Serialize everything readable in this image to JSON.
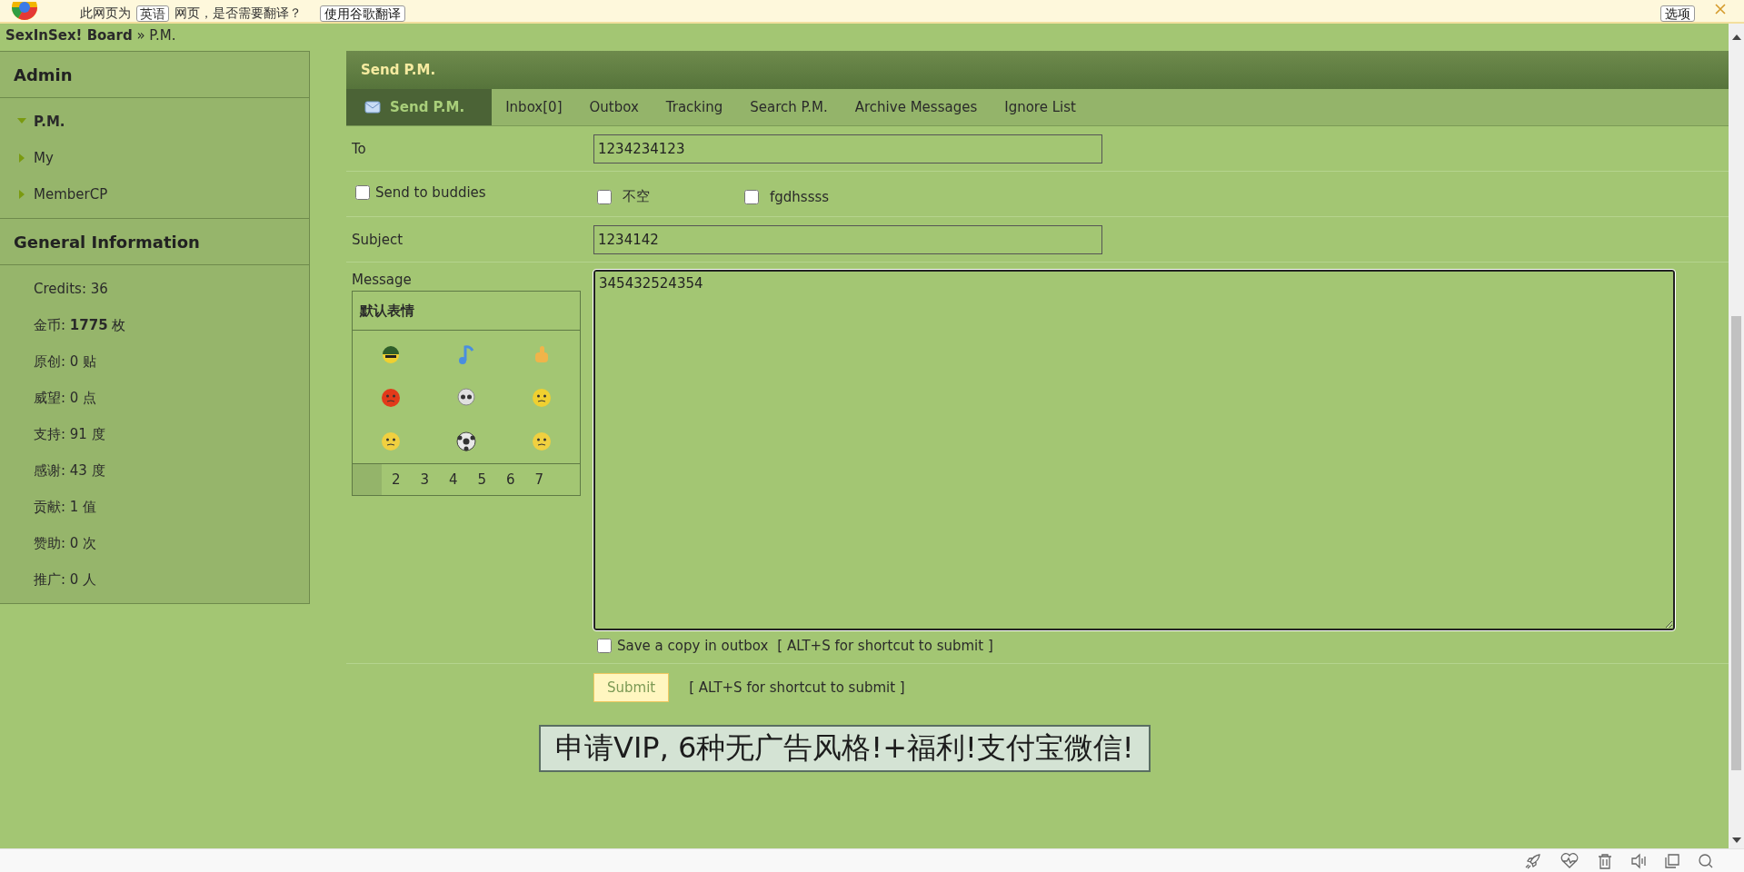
{
  "translate_bar": {
    "text_before": "此网页为",
    "language": "英语",
    "text_after": "网页，是否需要翻译？",
    "translate_button": "使用谷歌翻译",
    "options_button": "选项"
  },
  "breadcrumb": {
    "site": "SexInSex! Board",
    "trail": "» P.M."
  },
  "sidebar": {
    "sections": [
      {
        "title": "Admin",
        "kind": "menu",
        "items": [
          {
            "label": "P.M.",
            "expanded": true
          },
          {
            "label": "My",
            "expanded": false
          },
          {
            "label": "MemberCP",
            "expanded": false
          }
        ]
      },
      {
        "title": "General Information",
        "kind": "stats",
        "items": [
          {
            "label": "Credits: 36"
          },
          {
            "label": "金币: **1775** 枚"
          },
          {
            "label": "原创: 0 贴"
          },
          {
            "label": "威望: 0 点"
          },
          {
            "label": "支持: 91 度"
          },
          {
            "label": "感谢: 43 度"
          },
          {
            "label": "贡献: 1 值"
          },
          {
            "label": "赞助: 0 次"
          },
          {
            "label": "推广: 0 人"
          }
        ]
      }
    ]
  },
  "main": {
    "title": "Send P.M.",
    "tabs": [
      {
        "label": "Send P.M.",
        "selected": true
      },
      {
        "label": "Inbox[0]",
        "selected": false
      },
      {
        "label": "Outbox",
        "selected": false
      },
      {
        "label": "Tracking",
        "selected": false
      },
      {
        "label": "Search P.M.",
        "selected": false
      },
      {
        "label": "Archive Messages",
        "selected": false
      },
      {
        "label": "Ignore List",
        "selected": false
      }
    ],
    "to": {
      "label": "To",
      "value": "1234234123"
    },
    "send_to_buddies": {
      "label": "Send to buddies",
      "checked": false
    },
    "buddies": [
      {
        "label": "不空",
        "checked": false
      },
      {
        "label": "fgdhssss",
        "checked": false
      }
    ],
    "subject": {
      "label": "Subject",
      "value": "1234142"
    },
    "message": {
      "label": "Message",
      "value": "345432524354"
    },
    "smilies": {
      "title": "默认表情",
      "pages": [
        "2",
        "3",
        "4",
        "5",
        "6",
        "7"
      ]
    },
    "save_copy": {
      "label": "Save a copy in outbox",
      "checked": false
    },
    "save_hint": "[ ALT+S for shortcut to submit ]",
    "submit": "Submit",
    "submit_hint": "[ ALT+S for shortcut to submit ]"
  },
  "vip_banner": "申请VIP, 6种无广告风格!+福利!支付宝微信!"
}
